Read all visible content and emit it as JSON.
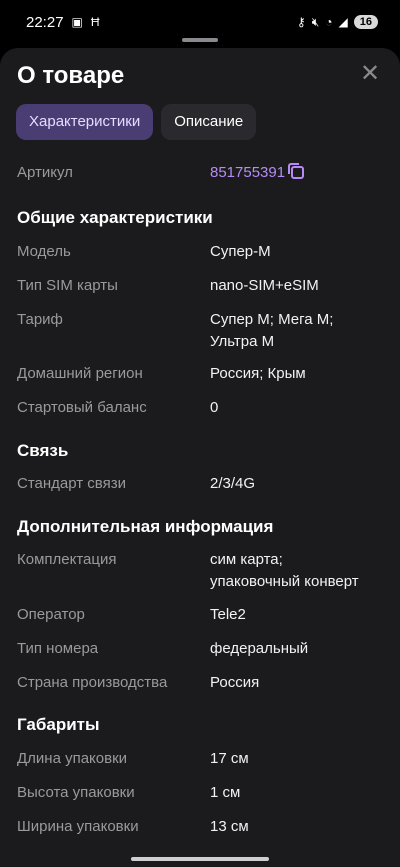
{
  "status": {
    "time": "22:27",
    "battery": "16"
  },
  "header": {
    "title": "О товаре"
  },
  "tabs": [
    {
      "label": "Характеристики",
      "active": true
    },
    {
      "label": "Описание",
      "active": false
    }
  ],
  "article": {
    "label": "Артикул",
    "value": "851755391"
  },
  "sections": {
    "general": {
      "title": "Общие характеристики",
      "rows": [
        {
          "label": "Модель",
          "value": "Супер-М"
        },
        {
          "label": "Тип SIM карты",
          "value": "nano-SIM+eSIM"
        },
        {
          "label": "Тариф",
          "value": "Супер М; Мега М;\nУльтра М"
        },
        {
          "label": "Домашний регион",
          "value": "Россия; Крым"
        },
        {
          "label": "Стартовый баланс",
          "value": "0"
        }
      ]
    },
    "connection": {
      "title": "Связь",
      "rows": [
        {
          "label": "Стандарт связи",
          "value": "2/3/4G"
        }
      ]
    },
    "additional": {
      "title": "Дополнительная информация",
      "rows": [
        {
          "label": "Комплектация",
          "value": "сим карта;\nупаковочный конверт"
        },
        {
          "label": "Оператор",
          "value": "Tele2"
        },
        {
          "label": "Тип номера",
          "value": "федеральный"
        },
        {
          "label": "Страна производства",
          "value": "Россия"
        }
      ]
    },
    "dimensions": {
      "title": "Габариты",
      "rows": [
        {
          "label": "Длина упаковки",
          "value": "17 см"
        },
        {
          "label": "Высота упаковки",
          "value": "1 см"
        },
        {
          "label": "Ширина упаковки",
          "value": "13 см"
        }
      ]
    }
  }
}
